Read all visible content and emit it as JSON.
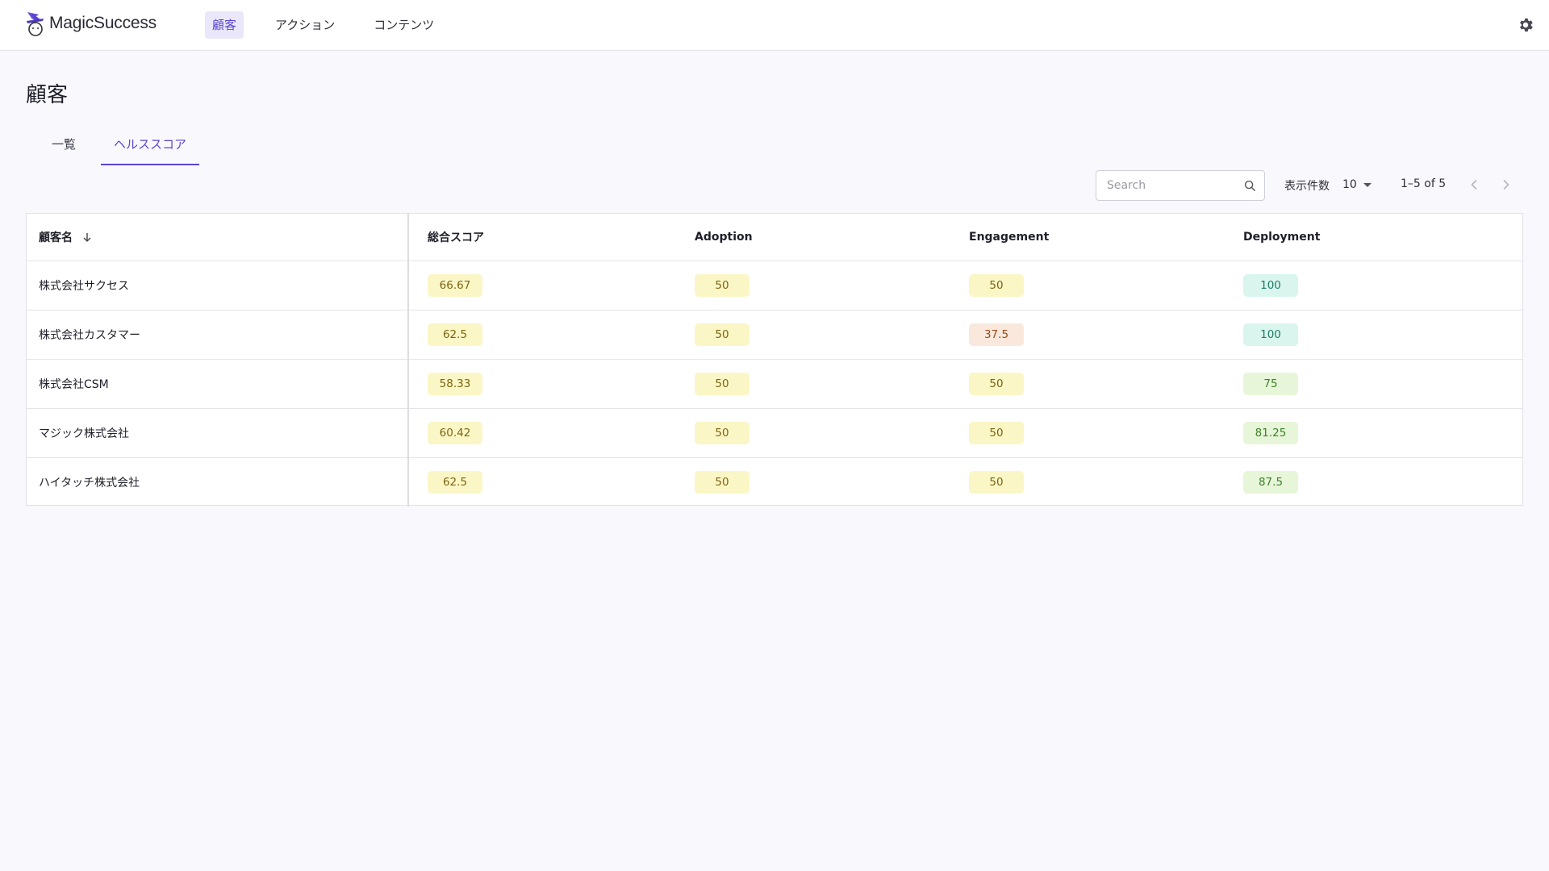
{
  "app": {
    "name": "MagicSuccess"
  },
  "nav": {
    "items": [
      "顧客",
      "アクション",
      "コンテンツ"
    ],
    "active": "顧客"
  },
  "page": {
    "title": "顧客"
  },
  "tabs": {
    "items": [
      "一覧",
      "ヘルススコア"
    ],
    "active": "ヘルススコア"
  },
  "toolbar": {
    "search_placeholder": "Search",
    "per_page_label": "表示件数",
    "per_page_value": "10",
    "range_text": "1–5 of 5"
  },
  "table": {
    "headers": [
      "顧客名",
      "総合スコア",
      "Adoption",
      "Engagement",
      "Deployment"
    ],
    "sort_column": "顧客名",
    "sort_direction": "descending",
    "rows": [
      {
        "name": "株式会社サクセス",
        "total": "66.67",
        "adoption": "50",
        "engagement": "50",
        "deployment": "100"
      },
      {
        "name": "株式会社カスタマー",
        "total": "62.5",
        "adoption": "50",
        "engagement": "37.5",
        "deployment": "100"
      },
      {
        "name": "株式会社CSM",
        "total": "58.33",
        "adoption": "50",
        "engagement": "50",
        "deployment": "75"
      },
      {
        "name": "マジック株式会社",
        "total": "60.42",
        "adoption": "50",
        "engagement": "50",
        "deployment": "81.25"
      },
      {
        "name": "ハイタッチ株式会社",
        "total": "62.5",
        "adoption": "50",
        "engagement": "50",
        "deployment": "87.5"
      }
    ]
  },
  "colors": {
    "accent": "#5a45cf",
    "chip_yellow": "#fbf6c6",
    "chip_orange": "#fbe8dc",
    "chip_teal": "#d9f5ee",
    "chip_green": "#e7f6d9"
  },
  "icons": [
    "wizard-logo-icon",
    "gear-icon",
    "search-icon",
    "sort-arrow-down-icon",
    "chevron-left-icon",
    "chevron-right-icon",
    "caret-down-icon"
  ]
}
